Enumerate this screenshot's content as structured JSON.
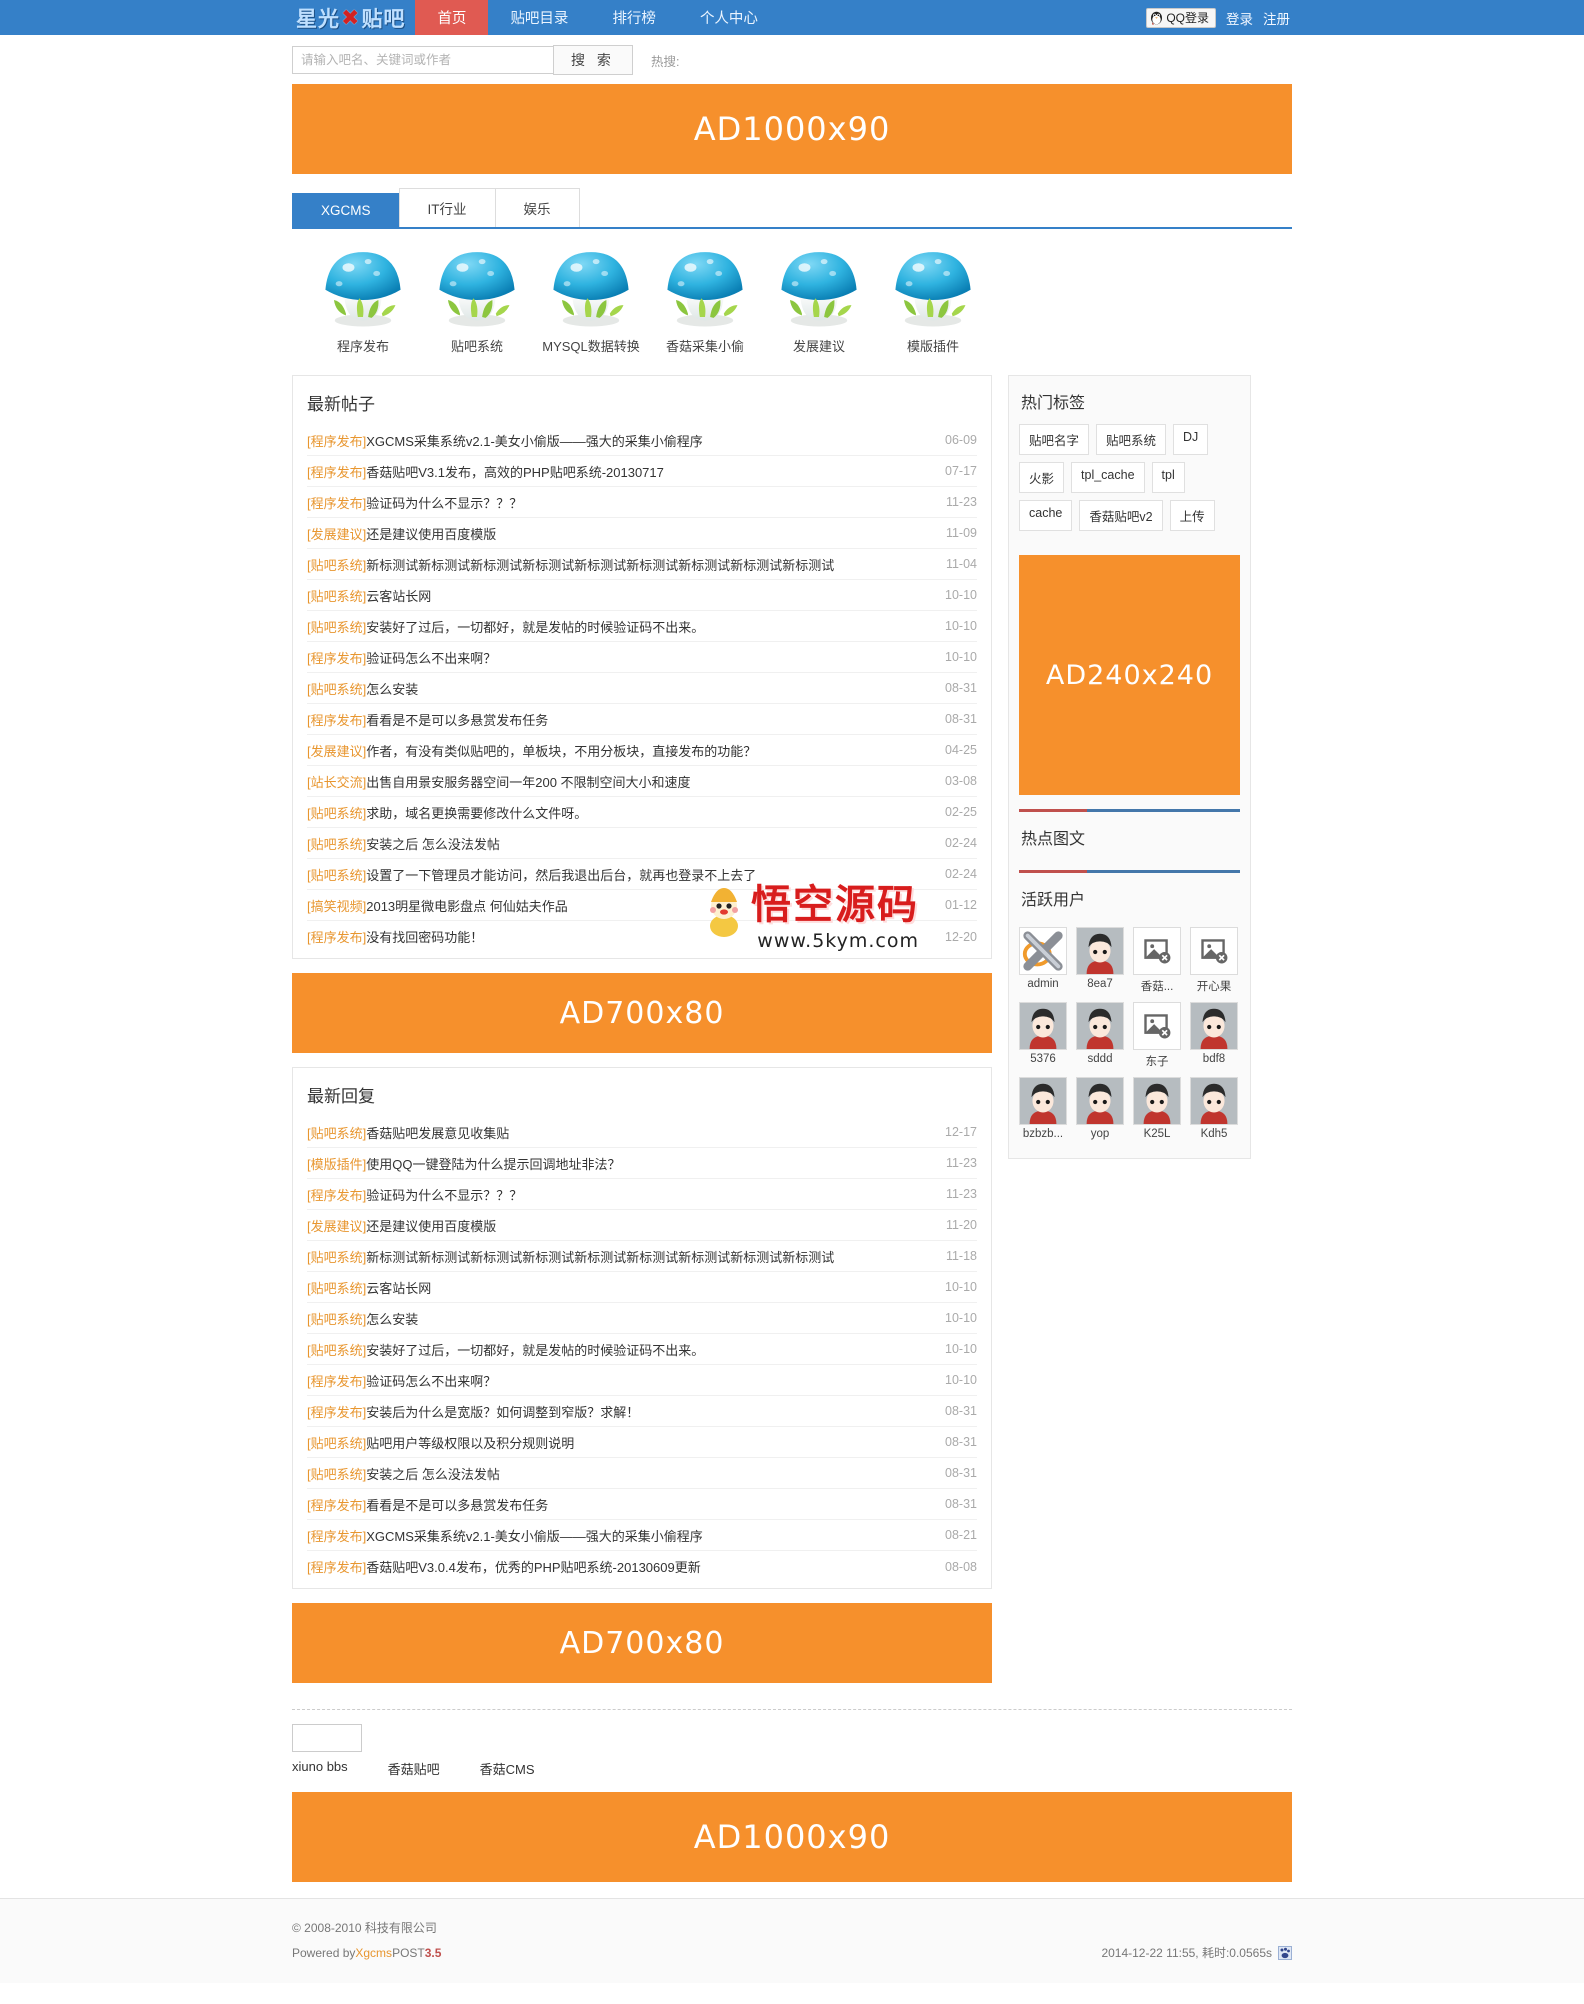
{
  "site": {
    "logo_text_1": "星光",
    "logo_mark": "✖",
    "logo_text_2": "贴吧"
  },
  "nav": {
    "items": [
      {
        "label": "首页",
        "active": true
      },
      {
        "label": "贴吧目录",
        "active": false
      },
      {
        "label": "排行榜",
        "active": false
      },
      {
        "label": "个人中心",
        "active": false
      }
    ],
    "qq_login": "QQ登录",
    "login": "登录",
    "register": "注册"
  },
  "search": {
    "placeholder": "请输入吧名、关键词或作者",
    "button": "搜 索",
    "hot_label": "热搜:"
  },
  "ads": {
    "top": "AD1000x90",
    "mid1": "AD700x80",
    "mid2": "AD700x80",
    "side": "AD240x240",
    "bottom": "AD1000x90"
  },
  "tabs": [
    {
      "label": "XGCMS",
      "active": true
    },
    {
      "label": "IT行业",
      "active": false
    },
    {
      "label": "娱乐",
      "active": false
    }
  ],
  "forums": [
    {
      "name": "程序发布",
      "icon": "mushroom-icon"
    },
    {
      "name": "贴吧系统",
      "icon": "mushroom-icon"
    },
    {
      "name": "MYSQL数据转换",
      "icon": "mushroom-icon"
    },
    {
      "name": "香菇采集小偷",
      "icon": "mushroom-icon"
    },
    {
      "name": "发展建议",
      "icon": "mushroom-icon"
    },
    {
      "name": "模版插件",
      "icon": "mushroom-icon"
    }
  ],
  "latest_posts": {
    "title": "最新帖子",
    "rows": [
      {
        "cat": "[程序发布]",
        "title": "XGCMS采集系统v2.1-美女小偷版——强大的采集小偷程序",
        "date": "06-09"
      },
      {
        "cat": "[程序发布]",
        "title": "香菇贴吧V3.1发布，高效的PHP贴吧系统-20130717",
        "date": "07-17"
      },
      {
        "cat": "[程序发布]",
        "title": "验证码为什么不显示？？？",
        "date": "11-23"
      },
      {
        "cat": "[发展建议]",
        "title": "还是建议使用百度模版",
        "date": "11-09"
      },
      {
        "cat": "[贴吧系统]",
        "title": "新标测试新标测试新标测试新标测试新标测试新标测试新标测试新标测试新标测试",
        "date": "11-04"
      },
      {
        "cat": "[贴吧系统]",
        "title": "云客站长网",
        "date": "10-10"
      },
      {
        "cat": "[贴吧系统]",
        "title": "安装好了过后，一切都好，就是发帖的时候验证码不出来。",
        "date": "10-10"
      },
      {
        "cat": "[程序发布]",
        "title": "验证码怎么不出来啊？",
        "date": "10-10"
      },
      {
        "cat": "[贴吧系统]",
        "title": "怎么安装",
        "date": "08-31"
      },
      {
        "cat": "[程序发布]",
        "title": "看看是不是可以多悬赏发布任务",
        "date": "08-31"
      },
      {
        "cat": "[发展建议]",
        "title": "作者，有没有类似贴吧的，单板块，不用分板块，直接发布的功能？",
        "date": "04-25"
      },
      {
        "cat": "[站长交流]",
        "title": "出售自用景安服务器空间一年200 不限制空间大小和速度",
        "date": "03-08"
      },
      {
        "cat": "[贴吧系统]",
        "title": "求助，域名更换需要修改什么文件呀。",
        "date": "02-25"
      },
      {
        "cat": "[贴吧系统]",
        "title": "安装之后 怎么没法发帖",
        "date": "02-24"
      },
      {
        "cat": "[贴吧系统]",
        "title": "设置了一下管理员才能访问，然后我退出后台，就再也登录不上去了",
        "date": "02-24"
      },
      {
        "cat": "[搞笑视频]",
        "title": "2013明星微电影盘点 何仙姑夫作品",
        "date": "01-12"
      },
      {
        "cat": "[程序发布]",
        "title": "没有找回密码功能！",
        "date": "12-20"
      }
    ]
  },
  "latest_replies": {
    "title": "最新回复",
    "rows": [
      {
        "cat": "[贴吧系统]",
        "title": "香菇贴吧发展意见收集贴",
        "date": "12-17"
      },
      {
        "cat": "[模版插件]",
        "title": "使用QQ一键登陆为什么提示回调地址非法？",
        "date": "11-23"
      },
      {
        "cat": "[程序发布]",
        "title": "验证码为什么不显示？？？",
        "date": "11-23"
      },
      {
        "cat": "[发展建议]",
        "title": "还是建议使用百度模版",
        "date": "11-20"
      },
      {
        "cat": "[贴吧系统]",
        "title": "新标测试新标测试新标测试新标测试新标测试新标测试新标测试新标测试新标测试",
        "date": "11-18"
      },
      {
        "cat": "[贴吧系统]",
        "title": "云客站长网",
        "date": "10-10"
      },
      {
        "cat": "[贴吧系统]",
        "title": "怎么安装",
        "date": "10-10"
      },
      {
        "cat": "[贴吧系统]",
        "title": "安装好了过后，一切都好，就是发帖的时候验证码不出来。",
        "date": "10-10"
      },
      {
        "cat": "[程序发布]",
        "title": "验证码怎么不出来啊？",
        "date": "10-10"
      },
      {
        "cat": "[程序发布]",
        "title": "安装后为什么是宽版？如何调整到窄版？求解！",
        "date": "08-31"
      },
      {
        "cat": "[贴吧系统]",
        "title": "贴吧用户等级权限以及积分规则说明",
        "date": "08-31"
      },
      {
        "cat": "[贴吧系统]",
        "title": "安装之后 怎么没法发帖",
        "date": "08-31"
      },
      {
        "cat": "[程序发布]",
        "title": "看看是不是可以多悬赏发布任务",
        "date": "08-31"
      },
      {
        "cat": "[程序发布]",
        "title": "XGCMS采集系统v2.1-美女小偷版——强大的采集小偷程序",
        "date": "08-21"
      },
      {
        "cat": "[程序发布]",
        "title": "香菇贴吧V3.0.4发布，优秀的PHP贴吧系统-20130609更新",
        "date": "08-08"
      }
    ]
  },
  "sidebar": {
    "hot_tags_title": "热门标签",
    "tags": [
      "贴吧名字",
      "贴吧系统",
      "DJ",
      "火影",
      "tpl_cache",
      "tpl",
      "cache",
      "香菇贴吧v2",
      "上传"
    ],
    "hot_images_title": "热点图文",
    "active_users_title": "活跃用户",
    "users": [
      {
        "name": "admin",
        "avatar": "x-logo-avatar"
      },
      {
        "name": "8ea7",
        "avatar": "person-avatar"
      },
      {
        "name": "香菇...",
        "avatar": "broken-image-avatar"
      },
      {
        "name": "开心果",
        "avatar": "broken-image-avatar"
      },
      {
        "name": "5376",
        "avatar": "person-avatar"
      },
      {
        "name": "sddd",
        "avatar": "person-avatar"
      },
      {
        "name": "东子",
        "avatar": "broken-image-avatar"
      },
      {
        "name": "bdf8",
        "avatar": "person-avatar"
      },
      {
        "name": "bzbzb...",
        "avatar": "person-avatar"
      },
      {
        "name": "yop",
        "avatar": "person-avatar"
      },
      {
        "name": "K25L",
        "avatar": "person-avatar"
      },
      {
        "name": "Kdh5",
        "avatar": "person-avatar"
      }
    ]
  },
  "bottom_links": [
    "xiuno bbs",
    "香菇贴吧",
    "香菇CMS"
  ],
  "footer": {
    "copyright": "© 2008-2010 科技有限公司",
    "powered_prefix": "Powered by ",
    "powered_link": "Xgcms",
    "powered_mid": " POST ",
    "powered_version": "3.5",
    "stats": "2014-12-22 11:55, 耗时:0.0565s"
  },
  "watermark": {
    "text": "悟空源码",
    "sub": "www.5kym.com"
  },
  "colors": {
    "nav_blue": "#3580c8",
    "active_red": "#e05a52",
    "ad_orange": "#f6902c",
    "category_orange": "#e8962f",
    "divider_red": "#c0504d",
    "divider_blue": "#4477aa"
  }
}
